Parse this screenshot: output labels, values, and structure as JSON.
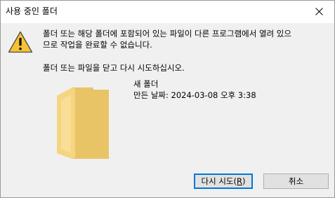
{
  "window": {
    "title": "사용 중인 폴더",
    "close_glyph": "✕"
  },
  "message": {
    "line1": "폴더 또는 해당 폴더에 포함되어 있는 파일이 다른 프로그램에서 열려 있으",
    "line2": "므로 작업을 완료할 수 없습니다.",
    "instruction": "폴더 또는 파일을 닫고 다시 시도하십시오."
  },
  "item": {
    "name": "새 폴더",
    "date_label": "만든 날짜: 2024-03-08 오후 3:38",
    "icon": "folder-icon"
  },
  "buttons": {
    "retry_prefix": "다시 시도(",
    "retry_mnemonic": "R",
    "retry_suffix": ")",
    "cancel_label": "취소"
  },
  "icons": {
    "warning": "warning-icon",
    "close": "close-icon"
  },
  "colors": {
    "warning_fill": "#f7c331",
    "folder_fill": "#f5d580",
    "focus_border": "#0078d7",
    "content_bg": "#f0f0f0"
  }
}
